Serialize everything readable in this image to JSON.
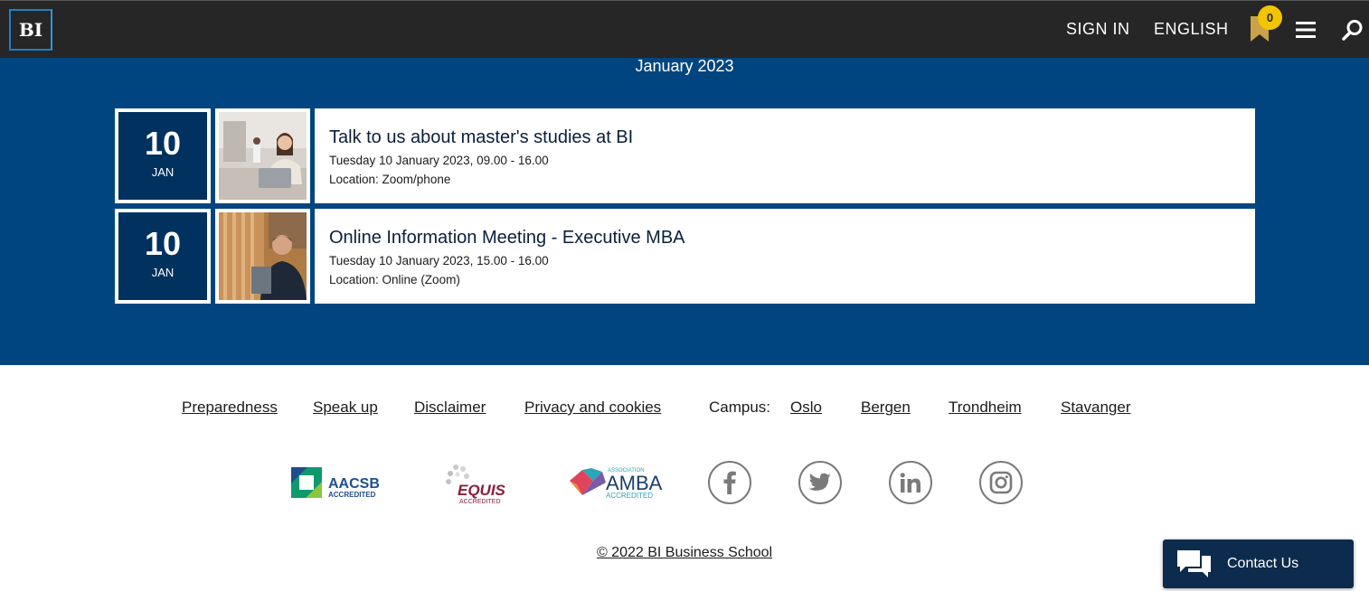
{
  "header": {
    "logo_text": "BI",
    "sign_in": "SIGN IN",
    "language": "ENGLISH",
    "bookmark_count": "0",
    "icons": [
      "bookmark-icon",
      "menu-icon",
      "search-icon"
    ],
    "colors": {
      "bar": "#262626",
      "badge": "#f2c500",
      "accent": "#1f7fc6"
    }
  },
  "events": {
    "month": "January 2023",
    "background": "#00457f",
    "items": [
      {
        "day": "10",
        "month_short": "JAN",
        "title": "Talk to us about master's studies at BI",
        "time": "Tuesday 10 January 2023, 09.00 - 16.00",
        "location": "Location: Zoom/phone"
      },
      {
        "day": "10",
        "month_short": "JAN",
        "title": "Online Information Meeting - Executive MBA",
        "time": "Tuesday 10 January 2023, 15.00 - 16.00",
        "location": "Location: Online (Zoom)"
      }
    ]
  },
  "footer": {
    "links": [
      "Preparedness",
      "Speak up",
      "Disclaimer",
      "Privacy and cookies"
    ],
    "campus_label": "Campus:",
    "campuses": [
      "Oslo",
      "Bergen",
      "Trondheim",
      "Stavanger"
    ],
    "accreditations": {
      "aacsb": {
        "name": "AACSB",
        "sub": "ACCREDITED"
      },
      "equis": {
        "name": "EQUIS",
        "sub": "ACCREDITED"
      },
      "amba": {
        "top": "ASSOCIATION",
        "name": "AMBA",
        "sub": "ACCREDITED"
      }
    },
    "social": [
      "facebook-icon",
      "twitter-icon",
      "linkedin-icon",
      "instagram-icon"
    ],
    "copyright": "© 2022 BI Business School"
  },
  "contact": {
    "label": "Contact Us",
    "icon": "chat-icon"
  }
}
